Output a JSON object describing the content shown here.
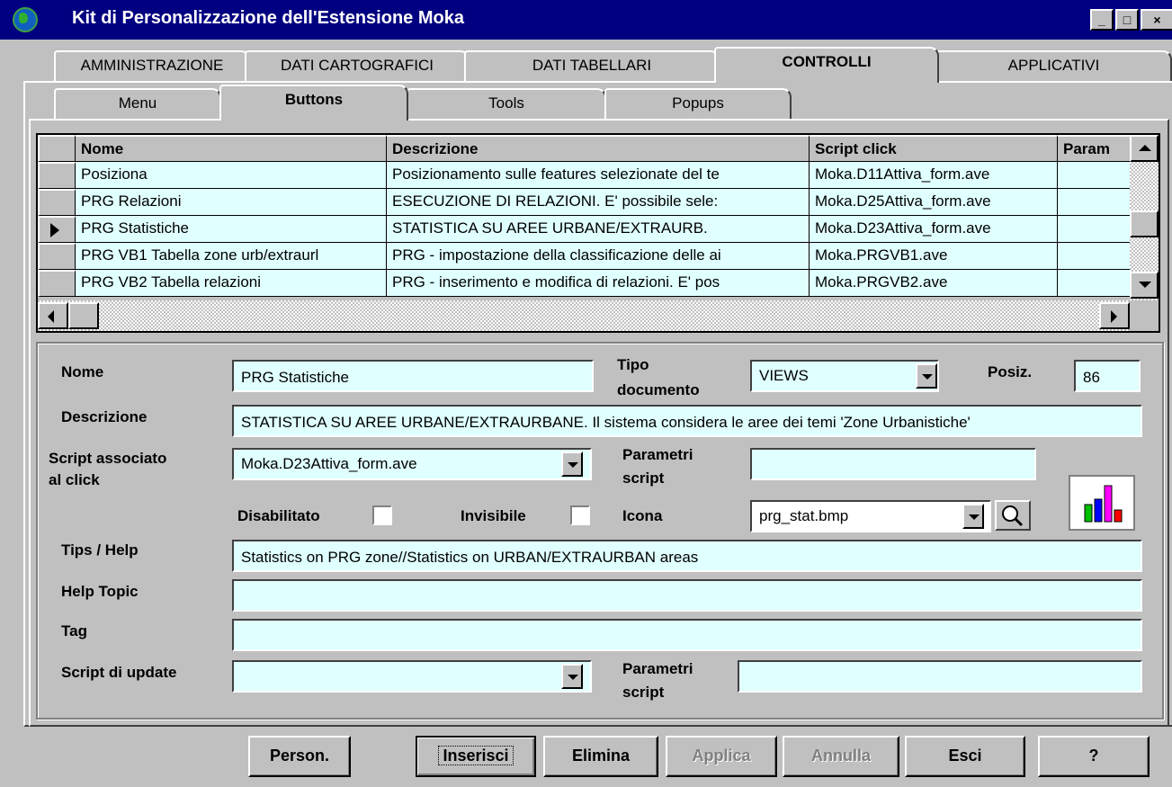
{
  "window": {
    "title": "Kit di Personalizzazione dell'Estensione Moka"
  },
  "main_tabs": [
    "AMMINISTRAZIONE",
    "DATI CARTOGRAFICI",
    "DATI TABELLARI",
    "CONTROLLI",
    "APPLICATIVI"
  ],
  "sub_tabs": [
    "Menu",
    "Buttons",
    "Tools",
    "Popups"
  ],
  "grid": {
    "headers": [
      "Nome",
      "Descrizione",
      "Script click",
      "Param"
    ],
    "rows": [
      [
        "Posiziona",
        "Posizionamento sulle features selezionate del te",
        "Moka.D11Attiva_form.ave",
        ""
      ],
      [
        "PRG Relazioni",
        "ESECUZIONE DI RELAZIONI. E' possibile sele:",
        "Moka.D25Attiva_form.ave",
        ""
      ],
      [
        "PRG Statistiche",
        "STATISTICA SU AREE URBANE/EXTRAURB.",
        "Moka.D23Attiva_form.ave",
        ""
      ],
      [
        "PRG VB1 Tabella zone urb/extraurl",
        "PRG - impostazione della classificazione delle ai",
        "Moka.PRGVB1.ave",
        ""
      ],
      [
        "PRG VB2 Tabella relazioni",
        "PRG - inserimento e modifica di relazioni. E' pos",
        "Moka.PRGVB2.ave",
        ""
      ]
    ]
  },
  "form": {
    "nome_label": "Nome",
    "nome_value": "PRG Statistiche",
    "tipo_label_1": "Tipo",
    "tipo_label_2": "documento",
    "tipo_value": "VIEWS",
    "posiz_label": "Posiz.",
    "posiz_value": "86",
    "descrizione_label": "Descrizione",
    "descrizione_value": "STATISTICA SU AREE URBANE/EXTRAURBANE. Il sistema considera le aree dei temi 'Zone Urbanistiche'",
    "script_label_1": "Script associato",
    "script_label_2": "al click",
    "script_value": "Moka.D23Attiva_form.ave",
    "param_label_1": "Parametri",
    "param_label_2": "script",
    "param_value": "",
    "disabilitato_label": "Disabilitato",
    "invisibile_label": "Invisibile",
    "icona_label": "Icona",
    "icona_value": "prg_stat.bmp",
    "tips_label": "Tips / Help",
    "tips_value": "Statistics on  PRG zone//Statistics on URBAN/EXTRAURBAN areas",
    "helptopic_label": "Help Topic",
    "helptopic_value": "",
    "tag_label": "Tag",
    "tag_value": "",
    "update_label": "Script di update",
    "update_value": "",
    "update_param_label_1": "Parametri",
    "update_param_label_2": "script",
    "update_param_value": ""
  },
  "buttons": [
    "Person.",
    "Inserisci",
    "Elimina",
    "Applica",
    "Annulla",
    "Esci",
    "?"
  ],
  "icon_preview": {
    "bar_colors": [
      "#00c000",
      "#0000ff",
      "#ff00ff",
      "#ff0000"
    ],
    "bar_levels": [
      0.45,
      0.6,
      0.95,
      0.3
    ]
  }
}
